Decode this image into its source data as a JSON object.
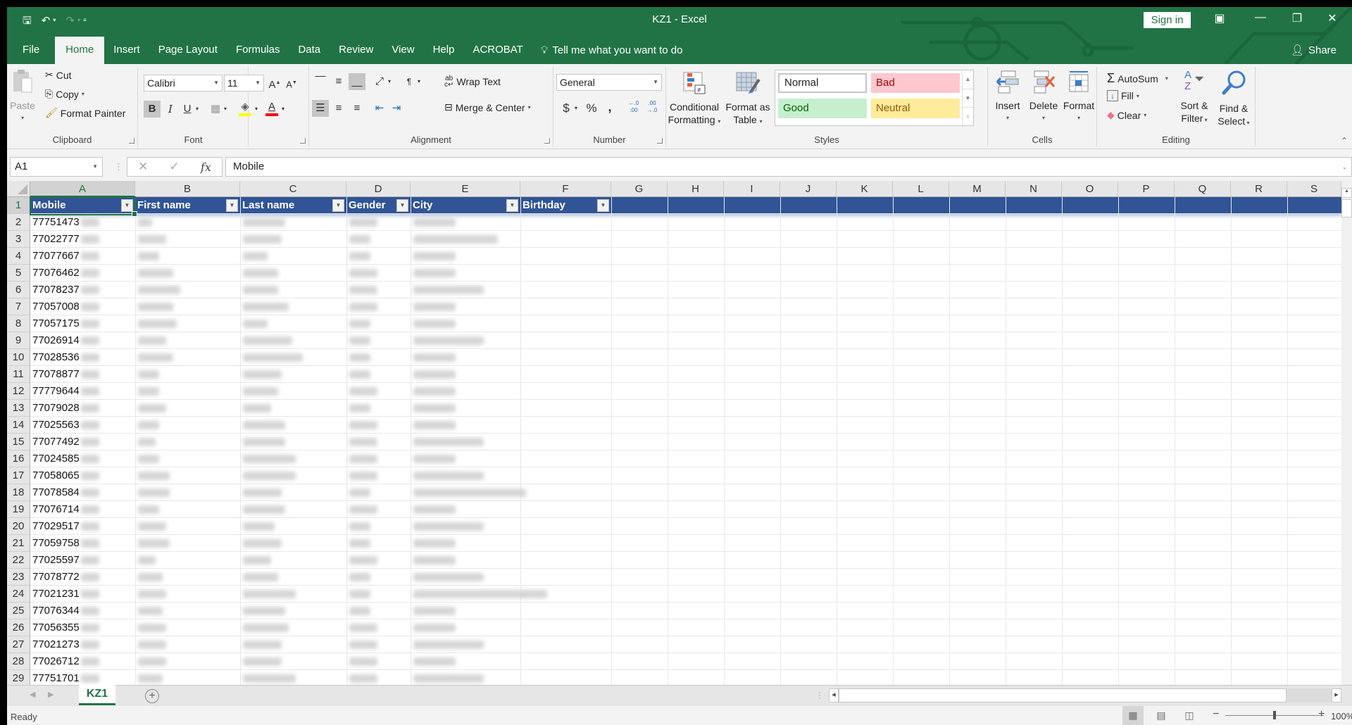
{
  "window": {
    "title": "KZ1  -  Excel",
    "sign_in": "Sign in",
    "share": "Share",
    "controls": {
      "ribbon_display": "▣",
      "minimize": "—",
      "restore": "❐",
      "close": "✕"
    }
  },
  "qat": {
    "save": "save-icon",
    "undo": "undo-icon",
    "redo": "redo-icon",
    "customize": "customize-qat-icon"
  },
  "tabs": [
    {
      "label": "File"
    },
    {
      "label": "Home",
      "active": true
    },
    {
      "label": "Insert"
    },
    {
      "label": "Page Layout"
    },
    {
      "label": "Formulas"
    },
    {
      "label": "Data"
    },
    {
      "label": "Review"
    },
    {
      "label": "View"
    },
    {
      "label": "Help"
    },
    {
      "label": "ACROBAT"
    }
  ],
  "tell_me": "Tell me what you want to do",
  "ribbon": {
    "clipboard": {
      "label": "Clipboard",
      "paste": "Paste",
      "cut": "Cut",
      "copy": "Copy",
      "format_painter": "Format Painter"
    },
    "font": {
      "label": "Font",
      "family": "Calibri",
      "size": "11",
      "bold": "B",
      "italic": "I",
      "underline": "U",
      "fill_color": "#ffff00",
      "font_color": "#ff0000"
    },
    "alignment": {
      "label": "Alignment",
      "wrap_text": "Wrap Text",
      "merge_center": "Merge & Center"
    },
    "number": {
      "label": "Number",
      "format": "General",
      "currency": "$",
      "percent": "%",
      "comma": ",",
      "inc_decimal": "←.0 .00",
      "dec_decimal": ".00 →.0"
    },
    "styles": {
      "label": "Styles",
      "conditional_formatting": [
        "Conditional",
        "Formatting"
      ],
      "format_as_table": [
        "Format as",
        "Table"
      ],
      "cells": [
        {
          "name": "Normal",
          "bg": "#ffffff",
          "fg": "#000000"
        },
        {
          "name": "Bad",
          "bg": "#ffc7ce",
          "fg": "#9c0006"
        },
        {
          "name": "Good",
          "bg": "#c6efce",
          "fg": "#006100"
        },
        {
          "name": "Neutral",
          "bg": "#ffeb9c",
          "fg": "#9c5700"
        }
      ]
    },
    "cells": {
      "label": "Cells",
      "insert": "Insert",
      "delete": "Delete",
      "format": "Format"
    },
    "editing": {
      "label": "Editing",
      "autosum": "AutoSum",
      "fill": "Fill",
      "clear": "Clear",
      "sort_filter": [
        "Sort &",
        "Filter"
      ],
      "find_select": [
        "Find &",
        "Select"
      ]
    }
  },
  "formula_bar": {
    "name_box": "A1",
    "cancel": "✕",
    "enter": "✓",
    "fx": "fx",
    "value": "Mobile"
  },
  "columns": [
    "A",
    "B",
    "C",
    "D",
    "E",
    "F",
    "G",
    "H",
    "I",
    "J",
    "K",
    "L",
    "M",
    "N",
    "O",
    "P",
    "Q",
    "R",
    "S"
  ],
  "selected_column": "A",
  "table": {
    "headers": [
      "Mobile",
      "First name",
      "Last name",
      "Gender",
      "City",
      "Birthday"
    ],
    "rows": [
      {
        "row": 2,
        "mobile": "77751473"
      },
      {
        "row": 3,
        "mobile": "77022777"
      },
      {
        "row": 4,
        "mobile": "77077667"
      },
      {
        "row": 5,
        "mobile": "77076462"
      },
      {
        "row": 6,
        "mobile": "77078237"
      },
      {
        "row": 7,
        "mobile": "77057008"
      },
      {
        "row": 8,
        "mobile": "77057175"
      },
      {
        "row": 9,
        "mobile": "77026914"
      },
      {
        "row": 10,
        "mobile": "77028536"
      },
      {
        "row": 11,
        "mobile": "77078877"
      },
      {
        "row": 12,
        "mobile": "77779644"
      },
      {
        "row": 13,
        "mobile": "77079028"
      },
      {
        "row": 14,
        "mobile": "77025563"
      },
      {
        "row": 15,
        "mobile": "77077492"
      },
      {
        "row": 16,
        "mobile": "77024585"
      },
      {
        "row": 17,
        "mobile": "77058065"
      },
      {
        "row": 18,
        "mobile": "77078584"
      },
      {
        "row": 19,
        "mobile": "77076714"
      },
      {
        "row": 20,
        "mobile": "77029517"
      },
      {
        "row": 21,
        "mobile": "77059758"
      },
      {
        "row": 22,
        "mobile": "77025597"
      },
      {
        "row": 23,
        "mobile": "77078772"
      },
      {
        "row": 24,
        "mobile": "77021231"
      },
      {
        "row": 25,
        "mobile": "77076344"
      },
      {
        "row": 26,
        "mobile": "77056355"
      },
      {
        "row": 27,
        "mobile": "77021273"
      },
      {
        "row": 28,
        "mobile": "77026712"
      },
      {
        "row": 29,
        "mobile": "77751701"
      }
    ],
    "redacted_columns": [
      "First name",
      "Last name",
      "Gender",
      "City"
    ]
  },
  "sheet_tabs": [
    {
      "label": "KZ1",
      "active": true
    }
  ],
  "status": {
    "text": "Ready",
    "zoom": "100%",
    "zoom_fraction": 0.5
  }
}
